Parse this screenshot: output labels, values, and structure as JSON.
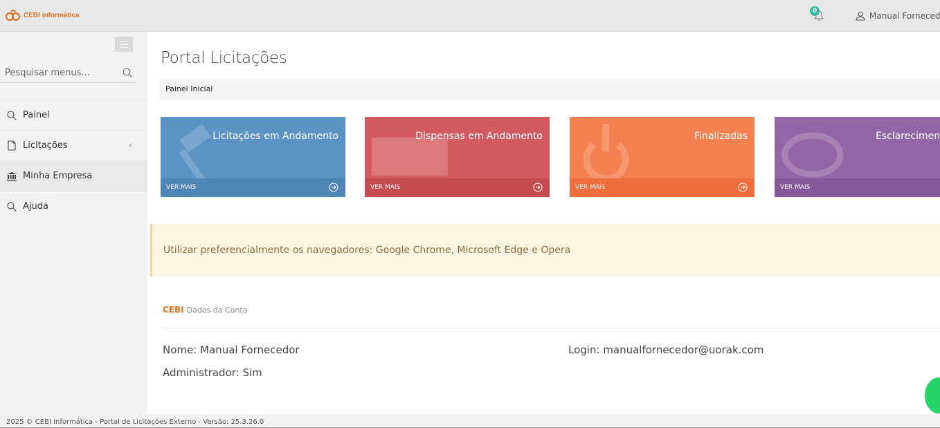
{
  "header": {
    "logo_text": "CEBI informática",
    "notification_count": "0",
    "user_name": "Manual Fornecedor"
  },
  "sidebar": {
    "search_placeholder": "Pesquisar menus...",
    "items": [
      {
        "label": "Painel",
        "icon": "search-icon"
      },
      {
        "label": "Licitações",
        "icon": "document-icon"
      },
      {
        "label": "Minha Empresa",
        "icon": "bank-icon"
      },
      {
        "label": "Ajuda",
        "icon": "search-icon"
      }
    ]
  },
  "main": {
    "page_title": "Portal Licitações",
    "breadcrumb": "Painel Inicial",
    "tiles": [
      {
        "title": "Licitações em Andamento",
        "link": "VER MAIS",
        "color": "#5b93c4"
      },
      {
        "title": "Dispensas em Andamento",
        "link": "VER MAIS",
        "color": "#d35b5f"
      },
      {
        "title": "Finalizadas",
        "link": "VER MAIS",
        "color": "#f5804f"
      },
      {
        "title": "Esclarecimentos",
        "link": "VER MAIS",
        "color": "#9566a7"
      }
    ],
    "alert": "Utilizar preferencialmente os navegadores: Google Chrome, Microsoft Edge e Opera",
    "account": {
      "brand": "CEBI",
      "heading": "Dados da Conta",
      "name": "Nome: Manual Fornecedor",
      "admin": "Administrador: Sim",
      "login": "Login: manualfornecedor@uorak.com"
    }
  },
  "footer": {
    "text": "2025 © CEBI Informática - Portal de Licitações Externo - Versão: 25.3.26.0"
  }
}
